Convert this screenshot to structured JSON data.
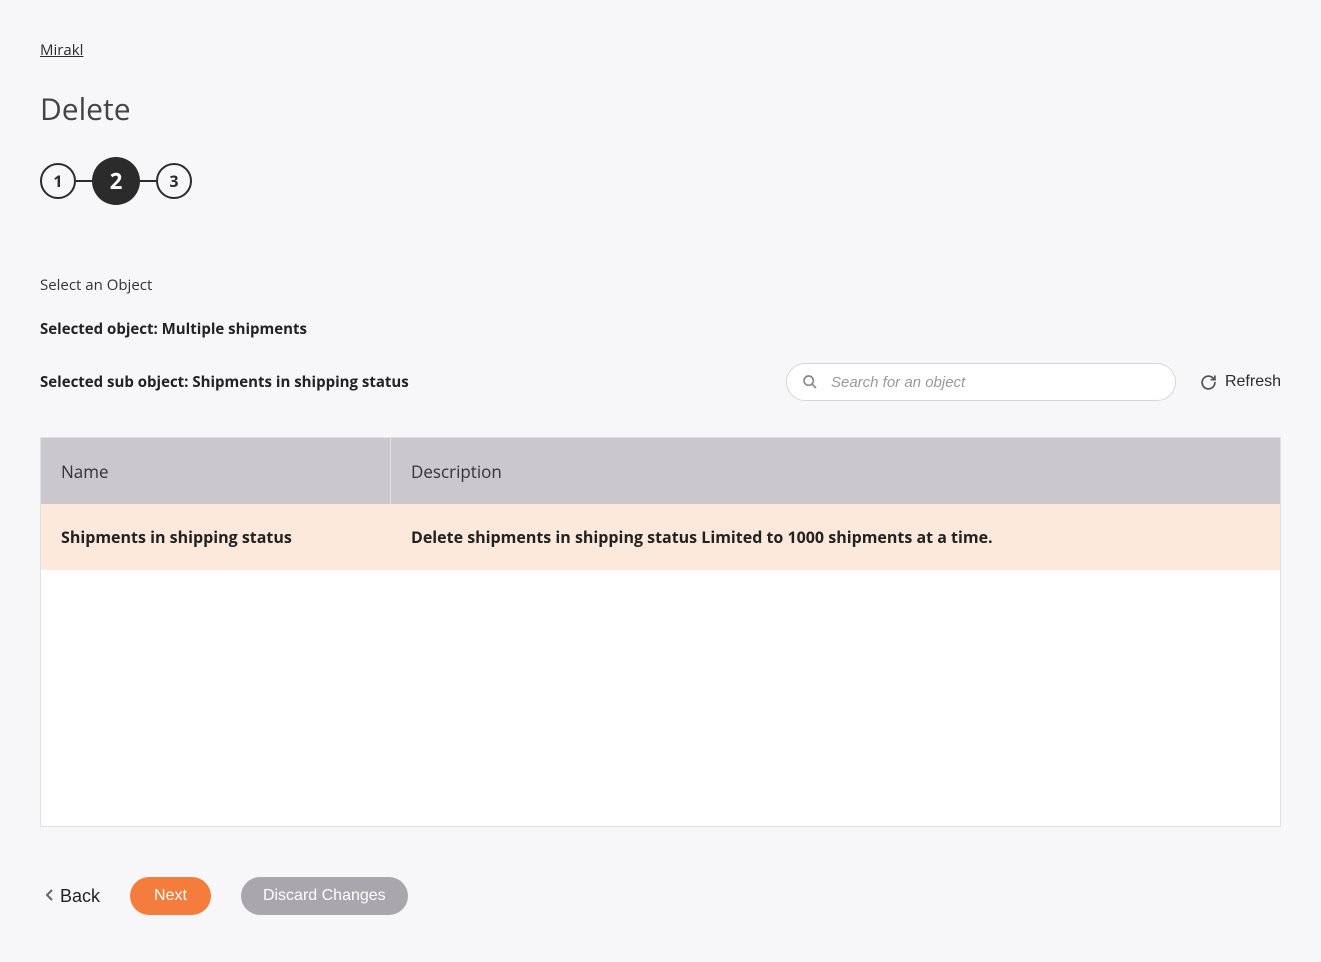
{
  "breadcrumb": "Mirakl",
  "page_title": "Delete",
  "stepper": {
    "steps": [
      "1",
      "2",
      "3"
    ],
    "active_index": 1
  },
  "instruction": "Select an Object",
  "selected_object_line": "Selected object: Multiple shipments",
  "selected_subobject_line": "Selected sub object: Shipments in shipping status",
  "search": {
    "placeholder": "Search for an object",
    "value": ""
  },
  "refresh_label": "Refresh",
  "table": {
    "headers": {
      "name": "Name",
      "description": "Description"
    },
    "rows": [
      {
        "name": "Shipments in shipping status",
        "description": "Delete shipments in shipping status Limited to 1000 shipments at a time.",
        "selected": true
      }
    ]
  },
  "actions": {
    "back": "Back",
    "next": "Next",
    "discard": "Discard Changes"
  }
}
